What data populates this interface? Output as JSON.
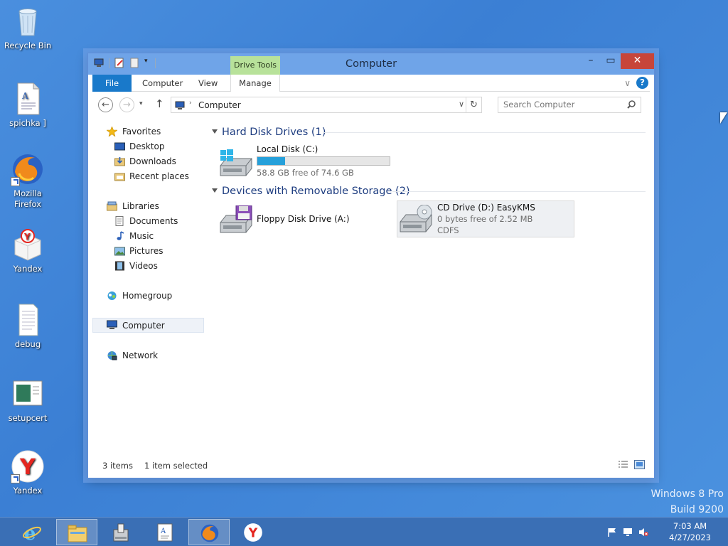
{
  "desktop": {
    "icons": [
      {
        "label": "Recycle Bin"
      },
      {
        "label": "spichka ]"
      },
      {
        "label": "Mozilla Firefox"
      },
      {
        "label": "Yandex"
      },
      {
        "label": "debug"
      },
      {
        "label": "setupcert"
      },
      {
        "label": "Yandex"
      }
    ],
    "watermark": {
      "line1": "Windows 8 Pro",
      "line2": "Build 9200"
    }
  },
  "window": {
    "title": "Computer",
    "contextual_tab": "Drive Tools",
    "ribbon_tabs": [
      "File",
      "Computer",
      "View",
      "Manage"
    ],
    "address": "Computer",
    "search_placeholder": "Search Computer"
  },
  "navpane": {
    "favorites": "Favorites",
    "desktop": "Desktop",
    "downloads": "Downloads",
    "recent": "Recent places",
    "libraries": "Libraries",
    "documents": "Documents",
    "music": "Music",
    "pictures": "Pictures",
    "videos": "Videos",
    "homegroup": "Homegroup",
    "computer": "Computer",
    "network": "Network"
  },
  "content": {
    "groups": [
      {
        "title": "Hard Disk Drives (1)"
      },
      {
        "title": "Devices with Removable Storage (2)"
      }
    ],
    "local_disk": {
      "name": "Local Disk (C:)",
      "free": "58.8 GB free of 74.6 GB",
      "used_fraction": 0.212
    },
    "floppy": {
      "name": "Floppy Disk Drive (A:)"
    },
    "cd": {
      "name": "CD Drive (D:) EasyKMS",
      "free": "0 bytes free of 2.52 MB",
      "fs": "CDFS"
    }
  },
  "statusbar": {
    "items": "3 items",
    "selected": "1 item selected"
  },
  "taskbar": {
    "time": "7:03 AM",
    "date": "4/27/2023"
  },
  "colors": {
    "accent": "#1979ca",
    "titlebar": "#6fa4e8",
    "close": "#c7453a",
    "bar_fill": "#26a0da",
    "drive_tools": "#b8e29a"
  }
}
